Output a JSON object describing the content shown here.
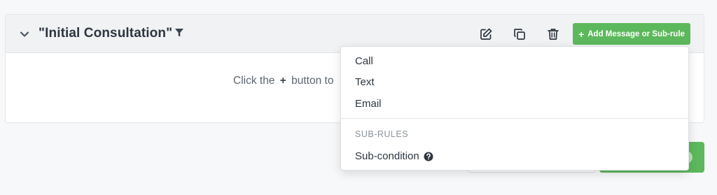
{
  "rule": {
    "title": "\"Initial Consultation\"",
    "add_button_label": "Add Message or Sub-rule",
    "add_button_plus": "+",
    "empty_prefix": "Click the",
    "empty_plus": "+",
    "empty_suffix": "button to"
  },
  "dropdown": {
    "items": [
      {
        "label": "Call"
      },
      {
        "label": "Text"
      },
      {
        "label": "Email"
      }
    ],
    "section_label": "SUB-RULES",
    "subcondition_label": "Sub-condition"
  },
  "icons": {
    "collapse": "chevron-down-icon",
    "filter": "filter-icon",
    "edit": "edit-icon",
    "copy": "copy-icon",
    "delete": "trash-icon",
    "help": "question-circle-icon"
  },
  "colors": {
    "accent_green": "#5cb85c",
    "text_dark": "#2d3640",
    "muted": "#8a939c"
  }
}
